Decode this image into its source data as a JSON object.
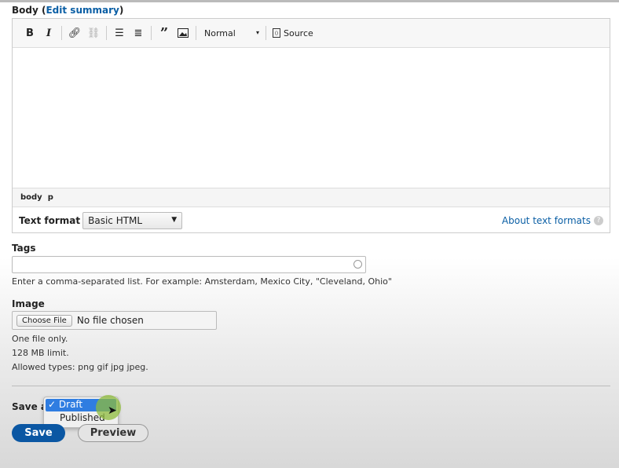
{
  "body_field": {
    "label": "Body",
    "edit_summary": "Edit summary"
  },
  "toolbar": {
    "bold": "B",
    "italic": "I",
    "heading_select": "Normal",
    "source": "Source"
  },
  "path": {
    "items": [
      "body",
      "p"
    ]
  },
  "text_format": {
    "label": "Text format",
    "value": "Basic HTML",
    "about": "About text formats"
  },
  "tags": {
    "label": "Tags",
    "value": "",
    "help": "Enter a comma-separated list. For example: Amsterdam, Mexico City, \"Cleveland, Ohio\""
  },
  "image": {
    "label": "Image",
    "choose": "Choose File",
    "status": "No file chosen",
    "help": [
      "One file only.",
      "128 MB limit.",
      "Allowed types: png gif jpg jpeg."
    ]
  },
  "save_as": {
    "label": "Save as",
    "options": [
      {
        "label": "Draft",
        "selected": true,
        "check": "✓"
      },
      {
        "label": "Published",
        "selected": false
      }
    ]
  },
  "actions": {
    "save": "Save",
    "preview": "Preview"
  },
  "colors": {
    "link": "#0b5fa5",
    "primary": "#0b57a3",
    "highlight": "#2f7de1",
    "cursor_halo": "#8dbb3c"
  }
}
